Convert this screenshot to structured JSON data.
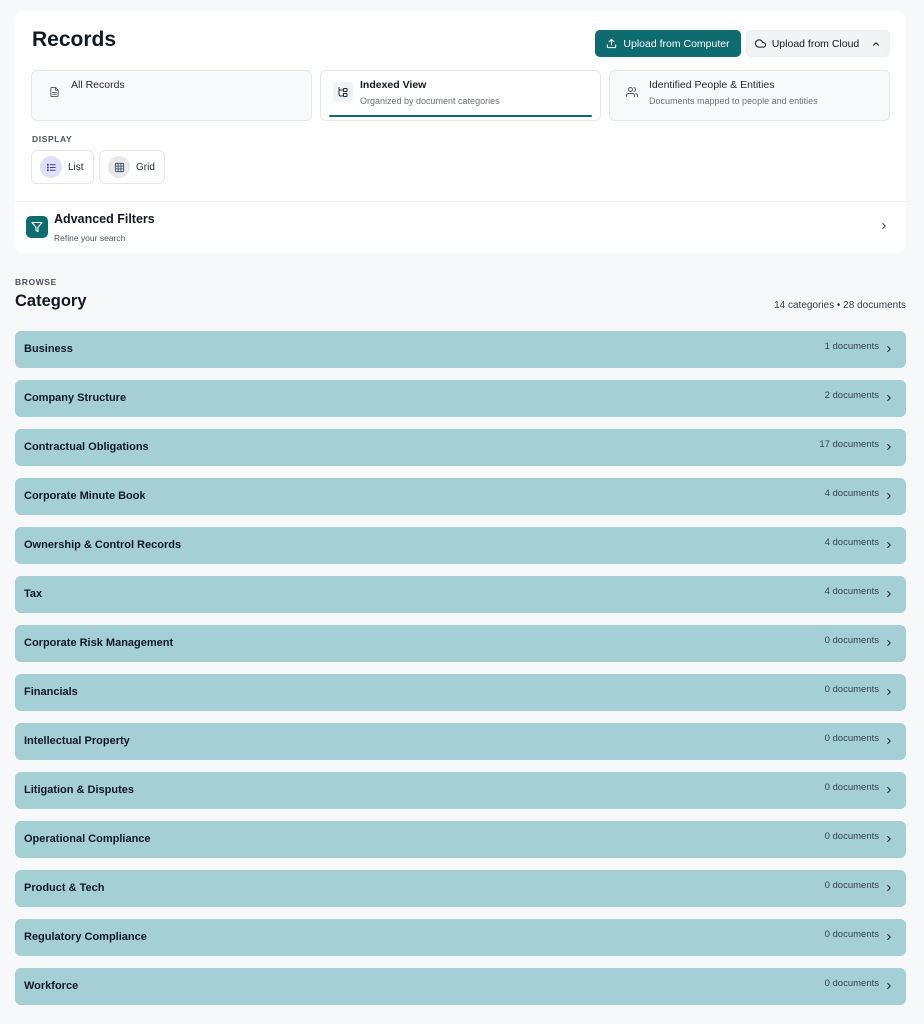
{
  "header": {
    "title": "Records",
    "upload_computer_label": "Upload from Computer",
    "upload_cloud_label": "Upload from Cloud"
  },
  "views": [
    {
      "label": "All Records",
      "sub": "",
      "icon": "document-icon",
      "active": false
    },
    {
      "label": "Indexed View",
      "sub": "Organized by document categories",
      "icon": "tree-index-icon",
      "active": true
    },
    {
      "label": "Identified People & Entities",
      "sub": "Documents mapped to people and entities",
      "icon": "users-icon",
      "active": false
    }
  ],
  "display": {
    "label": "DISPLAY",
    "list_label": "List",
    "grid_label": "Grid",
    "selected": "List"
  },
  "filters": {
    "title": "Advanced Filters",
    "subtitle": "Refine your search"
  },
  "browse": {
    "eyebrow": "BROWSE",
    "title": "Category",
    "summary": "14 categories • 28 documents",
    "categories": [
      {
        "name": "Business",
        "count": "1 documents"
      },
      {
        "name": "Company Structure",
        "count": "2 documents"
      },
      {
        "name": "Contractual Obligations",
        "count": "17 documents"
      },
      {
        "name": "Corporate Minute Book",
        "count": "4 documents"
      },
      {
        "name": "Ownership & Control Records",
        "count": "4 documents"
      },
      {
        "name": "Tax",
        "count": "4 documents"
      },
      {
        "name": "Corporate Risk Management",
        "count": "0 documents"
      },
      {
        "name": "Financials",
        "count": "0 documents"
      },
      {
        "name": "Intellectual Property",
        "count": "0 documents"
      },
      {
        "name": "Litigation & Disputes",
        "count": "0 documents"
      },
      {
        "name": "Operational Compliance",
        "count": "0 documents"
      },
      {
        "name": "Product & Tech",
        "count": "0 documents"
      },
      {
        "name": "Regulatory Compliance",
        "count": "0 documents"
      },
      {
        "name": "Workforce",
        "count": "0 documents"
      }
    ]
  },
  "colors": {
    "accent": "#0e6b70",
    "category_row": "#a4cfd5",
    "list_active": "#e0e0fb"
  }
}
